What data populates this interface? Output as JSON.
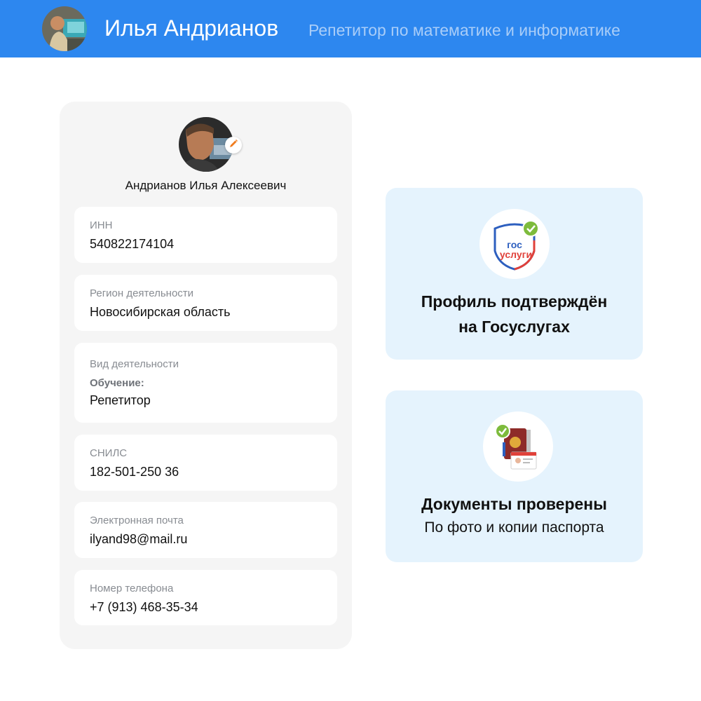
{
  "header": {
    "name": "Илья Андрианов",
    "subtitle": "Репетитор по математике и информатике",
    "background_color": "#2d87ef"
  },
  "profile": {
    "full_name": "Андрианов Илья Алексеевич",
    "edit_icon": "pencil-icon",
    "fields": [
      {
        "label": "ИНН",
        "value": "540822174104"
      },
      {
        "label": "Регион деятельности",
        "value": "Новосибирская область"
      },
      {
        "label": "Вид деятельности",
        "sub_label": "Обучение:",
        "value": "Репетитор"
      },
      {
        "label": "СНИЛС",
        "value": "182-501-250 36"
      },
      {
        "label": "Электронная почта",
        "value": "ilyand98@mail.ru"
      },
      {
        "label": "Номер телефона",
        "value": "+7 (913) 468-35-34"
      }
    ]
  },
  "gosuslugi_card": {
    "logo_top": "гос",
    "logo_bottom": "услуги",
    "title_line1": "Профиль подтверждён",
    "title_line2": "на Госуслугах",
    "icon": "gosuslugi-logo-icon"
  },
  "documents_card": {
    "title": "Документы проверены",
    "text": "По фото и копии паспорта",
    "icon": "passport-icon"
  },
  "colors": {
    "check_green": "#7dbb3c",
    "card_bg": "#e5f3fd",
    "accent_orange": "#f07c1e"
  }
}
